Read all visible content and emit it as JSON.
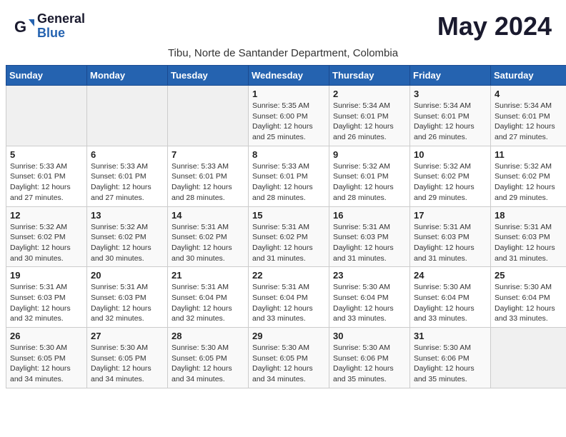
{
  "logo": {
    "general": "General",
    "blue": "Blue"
  },
  "month_title": "May 2024",
  "subtitle": "Tibu, Norte de Santander Department, Colombia",
  "weekdays": [
    "Sunday",
    "Monday",
    "Tuesday",
    "Wednesday",
    "Thursday",
    "Friday",
    "Saturday"
  ],
  "weeks": [
    [
      {
        "day": "",
        "info": ""
      },
      {
        "day": "",
        "info": ""
      },
      {
        "day": "",
        "info": ""
      },
      {
        "day": "1",
        "info": "Sunrise: 5:35 AM\nSunset: 6:00 PM\nDaylight: 12 hours\nand 25 minutes."
      },
      {
        "day": "2",
        "info": "Sunrise: 5:34 AM\nSunset: 6:01 PM\nDaylight: 12 hours\nand 26 minutes."
      },
      {
        "day": "3",
        "info": "Sunrise: 5:34 AM\nSunset: 6:01 PM\nDaylight: 12 hours\nand 26 minutes."
      },
      {
        "day": "4",
        "info": "Sunrise: 5:34 AM\nSunset: 6:01 PM\nDaylight: 12 hours\nand 27 minutes."
      }
    ],
    [
      {
        "day": "5",
        "info": "Sunrise: 5:33 AM\nSunset: 6:01 PM\nDaylight: 12 hours\nand 27 minutes."
      },
      {
        "day": "6",
        "info": "Sunrise: 5:33 AM\nSunset: 6:01 PM\nDaylight: 12 hours\nand 27 minutes."
      },
      {
        "day": "7",
        "info": "Sunrise: 5:33 AM\nSunset: 6:01 PM\nDaylight: 12 hours\nand 28 minutes."
      },
      {
        "day": "8",
        "info": "Sunrise: 5:33 AM\nSunset: 6:01 PM\nDaylight: 12 hours\nand 28 minutes."
      },
      {
        "day": "9",
        "info": "Sunrise: 5:32 AM\nSunset: 6:01 PM\nDaylight: 12 hours\nand 28 minutes."
      },
      {
        "day": "10",
        "info": "Sunrise: 5:32 AM\nSunset: 6:02 PM\nDaylight: 12 hours\nand 29 minutes."
      },
      {
        "day": "11",
        "info": "Sunrise: 5:32 AM\nSunset: 6:02 PM\nDaylight: 12 hours\nand 29 minutes."
      }
    ],
    [
      {
        "day": "12",
        "info": "Sunrise: 5:32 AM\nSunset: 6:02 PM\nDaylight: 12 hours\nand 30 minutes."
      },
      {
        "day": "13",
        "info": "Sunrise: 5:32 AM\nSunset: 6:02 PM\nDaylight: 12 hours\nand 30 minutes."
      },
      {
        "day": "14",
        "info": "Sunrise: 5:31 AM\nSunset: 6:02 PM\nDaylight: 12 hours\nand 30 minutes."
      },
      {
        "day": "15",
        "info": "Sunrise: 5:31 AM\nSunset: 6:02 PM\nDaylight: 12 hours\nand 31 minutes."
      },
      {
        "day": "16",
        "info": "Sunrise: 5:31 AM\nSunset: 6:03 PM\nDaylight: 12 hours\nand 31 minutes."
      },
      {
        "day": "17",
        "info": "Sunrise: 5:31 AM\nSunset: 6:03 PM\nDaylight: 12 hours\nand 31 minutes."
      },
      {
        "day": "18",
        "info": "Sunrise: 5:31 AM\nSunset: 6:03 PM\nDaylight: 12 hours\nand 31 minutes."
      }
    ],
    [
      {
        "day": "19",
        "info": "Sunrise: 5:31 AM\nSunset: 6:03 PM\nDaylight: 12 hours\nand 32 minutes."
      },
      {
        "day": "20",
        "info": "Sunrise: 5:31 AM\nSunset: 6:03 PM\nDaylight: 12 hours\nand 32 minutes."
      },
      {
        "day": "21",
        "info": "Sunrise: 5:31 AM\nSunset: 6:04 PM\nDaylight: 12 hours\nand 32 minutes."
      },
      {
        "day": "22",
        "info": "Sunrise: 5:31 AM\nSunset: 6:04 PM\nDaylight: 12 hours\nand 33 minutes."
      },
      {
        "day": "23",
        "info": "Sunrise: 5:30 AM\nSunset: 6:04 PM\nDaylight: 12 hours\nand 33 minutes."
      },
      {
        "day": "24",
        "info": "Sunrise: 5:30 AM\nSunset: 6:04 PM\nDaylight: 12 hours\nand 33 minutes."
      },
      {
        "day": "25",
        "info": "Sunrise: 5:30 AM\nSunset: 6:04 PM\nDaylight: 12 hours\nand 33 minutes."
      }
    ],
    [
      {
        "day": "26",
        "info": "Sunrise: 5:30 AM\nSunset: 6:05 PM\nDaylight: 12 hours\nand 34 minutes."
      },
      {
        "day": "27",
        "info": "Sunrise: 5:30 AM\nSunset: 6:05 PM\nDaylight: 12 hours\nand 34 minutes."
      },
      {
        "day": "28",
        "info": "Sunrise: 5:30 AM\nSunset: 6:05 PM\nDaylight: 12 hours\nand 34 minutes."
      },
      {
        "day": "29",
        "info": "Sunrise: 5:30 AM\nSunset: 6:05 PM\nDaylight: 12 hours\nand 34 minutes."
      },
      {
        "day": "30",
        "info": "Sunrise: 5:30 AM\nSunset: 6:06 PM\nDaylight: 12 hours\nand 35 minutes."
      },
      {
        "day": "31",
        "info": "Sunrise: 5:30 AM\nSunset: 6:06 PM\nDaylight: 12 hours\nand 35 minutes."
      },
      {
        "day": "",
        "info": ""
      }
    ]
  ]
}
